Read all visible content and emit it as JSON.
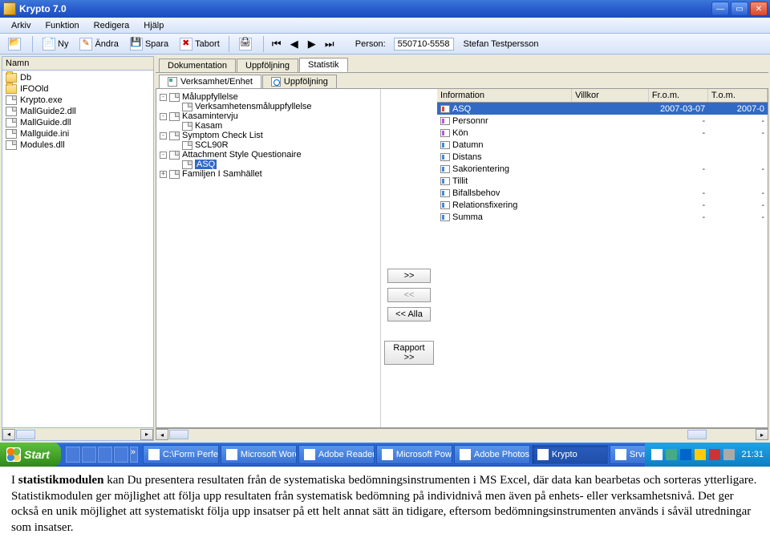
{
  "window": {
    "title": "Krypto 7.0",
    "menu": [
      "Arkiv",
      "Funktion",
      "Redigera",
      "Hjälp"
    ]
  },
  "toolbar": {
    "ny": "Ny",
    "andra": "Ändra",
    "spara": "Spara",
    "tabort": "Tabort",
    "person_lbl": "Person:",
    "person_id": "550710-5558",
    "person_name": "Stefan Testpersson"
  },
  "left_panel": {
    "header": "Namn",
    "items": [
      {
        "icon": "folder",
        "label": "Db"
      },
      {
        "icon": "folder",
        "label": "IFOOld"
      },
      {
        "icon": "file",
        "label": "Krypto.exe"
      },
      {
        "icon": "file",
        "label": "MallGuide2.dll"
      },
      {
        "icon": "file",
        "label": "MallGuide.dll"
      },
      {
        "icon": "file",
        "label": "Mallguide.ini"
      },
      {
        "icon": "file",
        "label": "Modules.dll"
      }
    ]
  },
  "main_tabs": [
    "Dokumentation",
    "Uppföljning",
    "Statistik"
  ],
  "main_tab_active": 2,
  "sub_tabs": [
    "Verksamhet/Enhet",
    "Uppföljning"
  ],
  "sub_tab_active": 0,
  "tree": [
    {
      "depth": 0,
      "twisty": "-",
      "icon": "file",
      "label": "Måluppfyllelse"
    },
    {
      "depth": 1,
      "twisty": "",
      "icon": "file",
      "label": "Verksamhetensmåluppfyllelse"
    },
    {
      "depth": 0,
      "twisty": "-",
      "icon": "file",
      "label": "Kasamintervju"
    },
    {
      "depth": 1,
      "twisty": "",
      "icon": "file",
      "label": "Kasam"
    },
    {
      "depth": 0,
      "twisty": "-",
      "icon": "file",
      "label": "Symptom Check List"
    },
    {
      "depth": 1,
      "twisty": "",
      "icon": "file",
      "label": "SCL90R"
    },
    {
      "depth": 0,
      "twisty": "-",
      "icon": "file",
      "label": "Attachment Style Questionaire"
    },
    {
      "depth": 1,
      "twisty": "",
      "icon": "file",
      "label": "ASQ",
      "selected": true
    },
    {
      "depth": 0,
      "twisty": "+",
      "icon": "file",
      "label": "Familjen I Samhället"
    }
  ],
  "buttons": {
    "add": ">>",
    "remove": "<<",
    "all": "<< Alla",
    "report": "Rapport >>"
  },
  "grid": {
    "headers": [
      "Information",
      "Villkor",
      "Fr.o.m.",
      "T.o.m."
    ],
    "rows": [
      {
        "icon": "r",
        "label": "ASQ",
        "c3": "2007-03-07",
        "c4": "2007-0",
        "sel": true
      },
      {
        "icon": "p",
        "label": "Personnr",
        "c3": "-",
        "c4": "-"
      },
      {
        "icon": "p",
        "label": "Kön",
        "c3": "-",
        "c4": "-"
      },
      {
        "icon": "b",
        "label": "Datumn",
        "c3": "",
        "c4": ""
      },
      {
        "icon": "b",
        "label": "Distans",
        "c3": "",
        "c4": ""
      },
      {
        "icon": "b",
        "label": "Sakorientering",
        "c3": "-",
        "c4": "-"
      },
      {
        "icon": "b",
        "label": "Tillit",
        "c3": "",
        "c4": ""
      },
      {
        "icon": "b",
        "label": "Bifallsbehov",
        "c3": "-",
        "c4": "-"
      },
      {
        "icon": "b",
        "label": "Relationsfixering",
        "c3": "-",
        "c4": "-"
      },
      {
        "icon": "b",
        "label": "Summa",
        "c3": "-",
        "c4": "-"
      }
    ]
  },
  "taskbar": {
    "start": "Start",
    "items": [
      {
        "label": "C:\\Form Perfec…"
      },
      {
        "label": "Microsoft Word …"
      },
      {
        "label": "Adobe Reader …"
      },
      {
        "label": "Microsoft Powe…"
      },
      {
        "label": "Adobe Photoshop…"
      },
      {
        "label": "Krypto",
        "active": true
      },
      {
        "label": "Srvmon"
      }
    ],
    "clock": "21:31"
  },
  "caption": {
    "lead": "I ",
    "bold": "statistikmodulen",
    "rest": " kan Du presentera resultaten från de systematiska bedömningsinstrumenten i MS Excel, där data kan bearbetas och sorteras ytterligare. Statistikmodulen ger möjlighet att följa upp resultaten från systematisk bedömning på individnivå men även på enhets- eller verksamhetsnivå. Det ger också en unik möjlighet att systematiskt följa upp insatser på ett helt annat sätt än tidigare, eftersom bedömningsinstrumenten används i såväl utredningar som insatser."
  }
}
